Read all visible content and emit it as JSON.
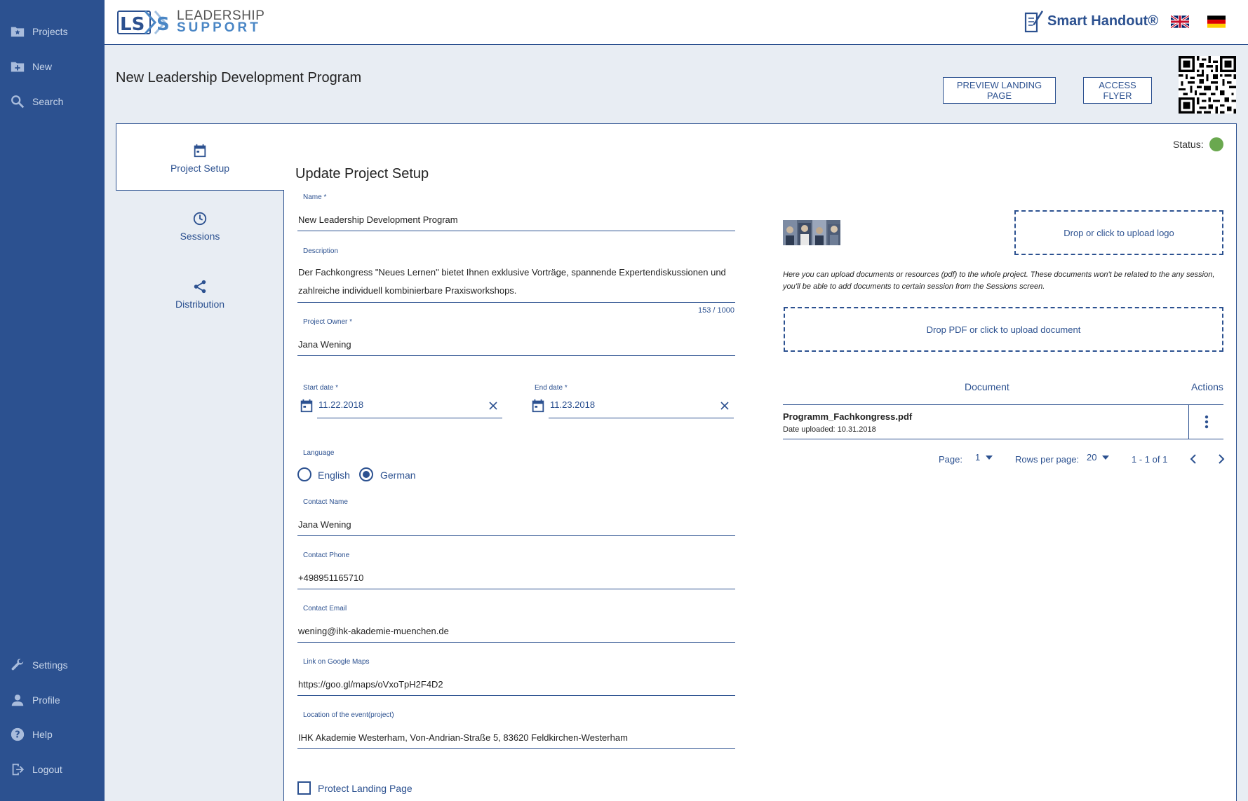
{
  "sidebar": {
    "items": [
      {
        "label": "Projects",
        "icon": "folder-star-icon"
      },
      {
        "label": "New",
        "icon": "folder-plus-icon"
      },
      {
        "label": "Search",
        "icon": "search-icon"
      }
    ],
    "bottom_items": [
      {
        "label": "Settings",
        "icon": "wrench-icon"
      },
      {
        "label": "Profile",
        "icon": "person-icon"
      },
      {
        "label": "Help",
        "icon": "help-icon"
      },
      {
        "label": "Logout",
        "icon": "logout-icon"
      }
    ]
  },
  "header": {
    "logo_mark": "LS S",
    "logo_line1": "LEADERSHIP",
    "logo_line2": "SUPPORT",
    "product_name": "Smart Handout®"
  },
  "page": {
    "title": "New Leadership Development Program",
    "preview_button": "PREVIEW LANDING PAGE",
    "flyer_button": "ACCESS FLYER"
  },
  "tabs": [
    {
      "label": "Project Setup",
      "icon": "calendar-icon",
      "active": true
    },
    {
      "label": "Sessions",
      "icon": "clock-icon",
      "active": false
    },
    {
      "label": "Distribution",
      "icon": "share-icon",
      "active": false
    }
  ],
  "status": {
    "label": "Status:",
    "color": "#6aa84f"
  },
  "form": {
    "title": "Update Project Setup",
    "name": {
      "label": "Name *",
      "value": "New Leadership Development Program"
    },
    "description": {
      "label": "Description",
      "line1": "Der Fachkongress \"Neues Lernen\" bietet Ihnen exklusive Vorträge, spannende Expertendiskussionen und",
      "line2": "zahlreiche individuell kombinierbare Praxisworkshops.",
      "counter": "153 / 1000"
    },
    "owner": {
      "label": "Project Owner *",
      "value": "Jana Wening"
    },
    "start_date": {
      "label": "Start date *",
      "value": "11.22.2018"
    },
    "end_date": {
      "label": "End date *",
      "value": "11.23.2018"
    },
    "language": {
      "label": "Language",
      "option1": "English",
      "option2": "German",
      "selected": "German"
    },
    "contact_name": {
      "label": "Contact Name",
      "value": "Jana Wening"
    },
    "contact_phone": {
      "label": "Contact Phone",
      "value": "+498951165710"
    },
    "contact_email": {
      "label": "Contact Email",
      "value": "wening@ihk-akademie-muenchen.de"
    },
    "maps_link": {
      "label": "Link on Google Maps",
      "value": "https://goo.gl/maps/oVxoTpH2F4D2"
    },
    "location": {
      "label": "Location of the event(project)",
      "value": "IHK Akademie Westerham, Von-Andrian-Straße 5, 83620 Feldkirchen-Westerham"
    },
    "protect_label": "Protect Landing Page"
  },
  "uploads": {
    "logo_drop": "Drop or click to upload logo",
    "help": "Here you can upload documents or resources (pdf) to the whole project. These documents won't be related to the any session, you'll be able to add documents to certain session from the Sessions screen.",
    "pdf_drop": "Drop PDF or click to upload document"
  },
  "documents": {
    "col_document": "Document",
    "col_actions": "Actions",
    "rows": [
      {
        "name": "Programm_Fachkongress.pdf",
        "date": "Date uploaded: 10.31.2018"
      }
    ],
    "page_label": "Page:",
    "page_value": "1",
    "rows_label": "Rows per page:",
    "rows_value": "20",
    "range": "1 - 1 of 1"
  }
}
